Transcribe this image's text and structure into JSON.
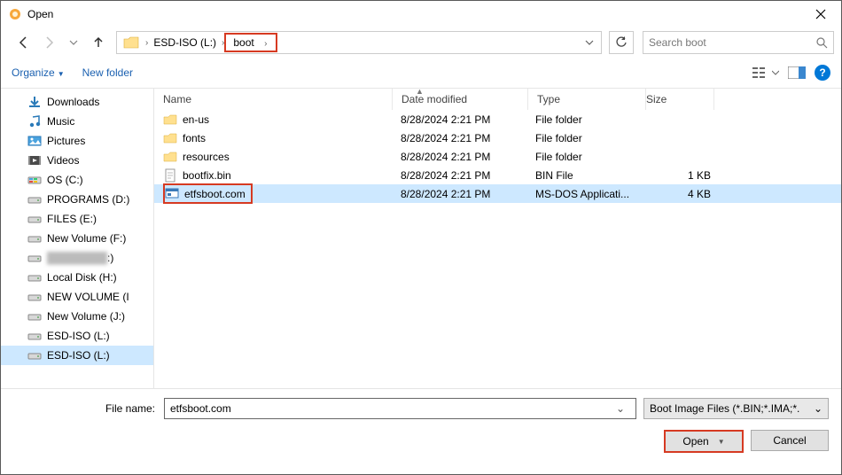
{
  "window": {
    "title": "Open"
  },
  "breadcrumb": {
    "seg1": "ESD-ISO (L:)",
    "seg2": "boot"
  },
  "search": {
    "placeholder": "Search boot"
  },
  "toolbar": {
    "organize": "Organize",
    "newfolder": "New folder"
  },
  "tree": {
    "items": [
      {
        "label": "Downloads",
        "icon": "download"
      },
      {
        "label": "Music",
        "icon": "music"
      },
      {
        "label": "Pictures",
        "icon": "pictures"
      },
      {
        "label": "Videos",
        "icon": "videos"
      },
      {
        "label": "OS (C:)",
        "icon": "drive-os"
      },
      {
        "label": "PROGRAMS (D:)",
        "icon": "drive"
      },
      {
        "label": "FILES (E:)",
        "icon": "drive"
      },
      {
        "label": "New Volume (F:)",
        "icon": "drive"
      },
      {
        "label": "",
        "icon": "drive",
        "obscured": true,
        "suffix": ":)"
      },
      {
        "label": "Local Disk (H:)",
        "icon": "drive"
      },
      {
        "label": "NEW VOLUME (I",
        "icon": "drive"
      },
      {
        "label": "New Volume (J:)",
        "icon": "drive"
      },
      {
        "label": "ESD-ISO (L:)",
        "icon": "drive"
      },
      {
        "label": "ESD-ISO (L:)",
        "icon": "drive",
        "selected": true
      }
    ]
  },
  "columns": {
    "name": "Name",
    "date": "Date modified",
    "type": "Type",
    "size": "Size"
  },
  "rows": [
    {
      "name": "en-us",
      "date": "8/28/2024 2:21 PM",
      "type": "File folder",
      "size": "",
      "icon": "folder"
    },
    {
      "name": "fonts",
      "date": "8/28/2024 2:21 PM",
      "type": "File folder",
      "size": "",
      "icon": "folder"
    },
    {
      "name": "resources",
      "date": "8/28/2024 2:21 PM",
      "type": "File folder",
      "size": "",
      "icon": "folder"
    },
    {
      "name": "bootfix.bin",
      "date": "8/28/2024 2:21 PM",
      "type": "BIN File",
      "size": "1 KB",
      "icon": "file"
    },
    {
      "name": "etfsboot.com",
      "date": "8/28/2024 2:21 PM",
      "type": "MS-DOS Applicati...",
      "size": "4 KB",
      "icon": "app",
      "selected": true,
      "boxed": true
    }
  ],
  "footer": {
    "filename_label": "File name:",
    "filename_value": "etfsboot.com",
    "filter": "Boot Image Files (*.BIN;*.IMA;*.",
    "open": "Open",
    "cancel": "Cancel"
  }
}
